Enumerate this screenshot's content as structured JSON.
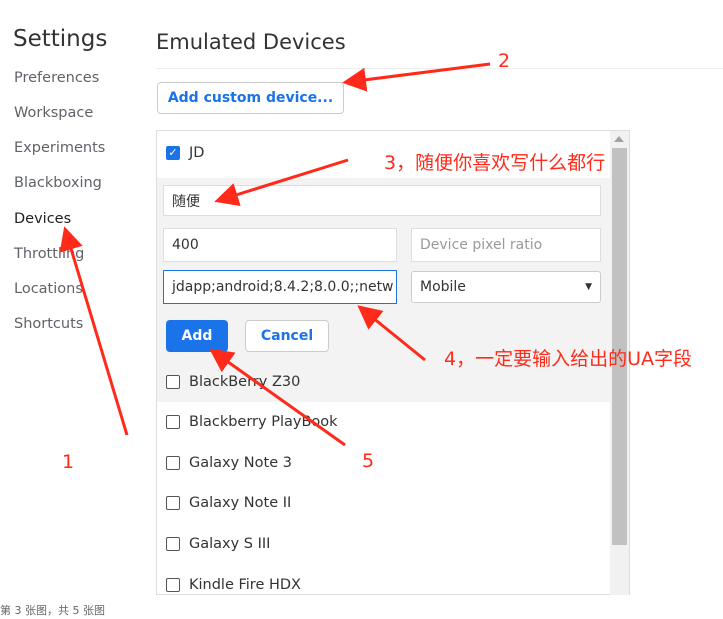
{
  "sidebar": {
    "title": "Settings",
    "items": [
      "Preferences",
      "Workspace",
      "Experiments",
      "Blackboxing",
      "Devices",
      "Throttling",
      "Locations",
      "Shortcuts"
    ],
    "selected": "Devices"
  },
  "main": {
    "title": "Emulated Devices",
    "add_custom_label": "Add custom device...",
    "editing_device": {
      "name": "JD",
      "checked": true
    },
    "form": {
      "name_value": "随便",
      "width_value": "400",
      "dpr_placeholder": "Device pixel ratio",
      "ua_value": "jdapp;android;8.4.2;8.0.0;;netw",
      "type_value": "Mobile",
      "add_label": "Add",
      "cancel_label": "Cancel"
    },
    "devices": [
      "BlackBerry Z30",
      "Blackberry PlayBook",
      "Galaxy Note 3",
      "Galaxy Note II",
      "Galaxy S III",
      "Kindle Fire HDX"
    ]
  },
  "annotations": {
    "a1": "1",
    "a2": "2",
    "a3": "3，随便你喜欢写什么都行",
    "a4": "4，一定要输入给出的UA字段",
    "a5": "5",
    "color": "#ff2a1a"
  },
  "footer": "第 3 张图，共 5 张图",
  "colors": {
    "accent": "#1a73e8"
  }
}
